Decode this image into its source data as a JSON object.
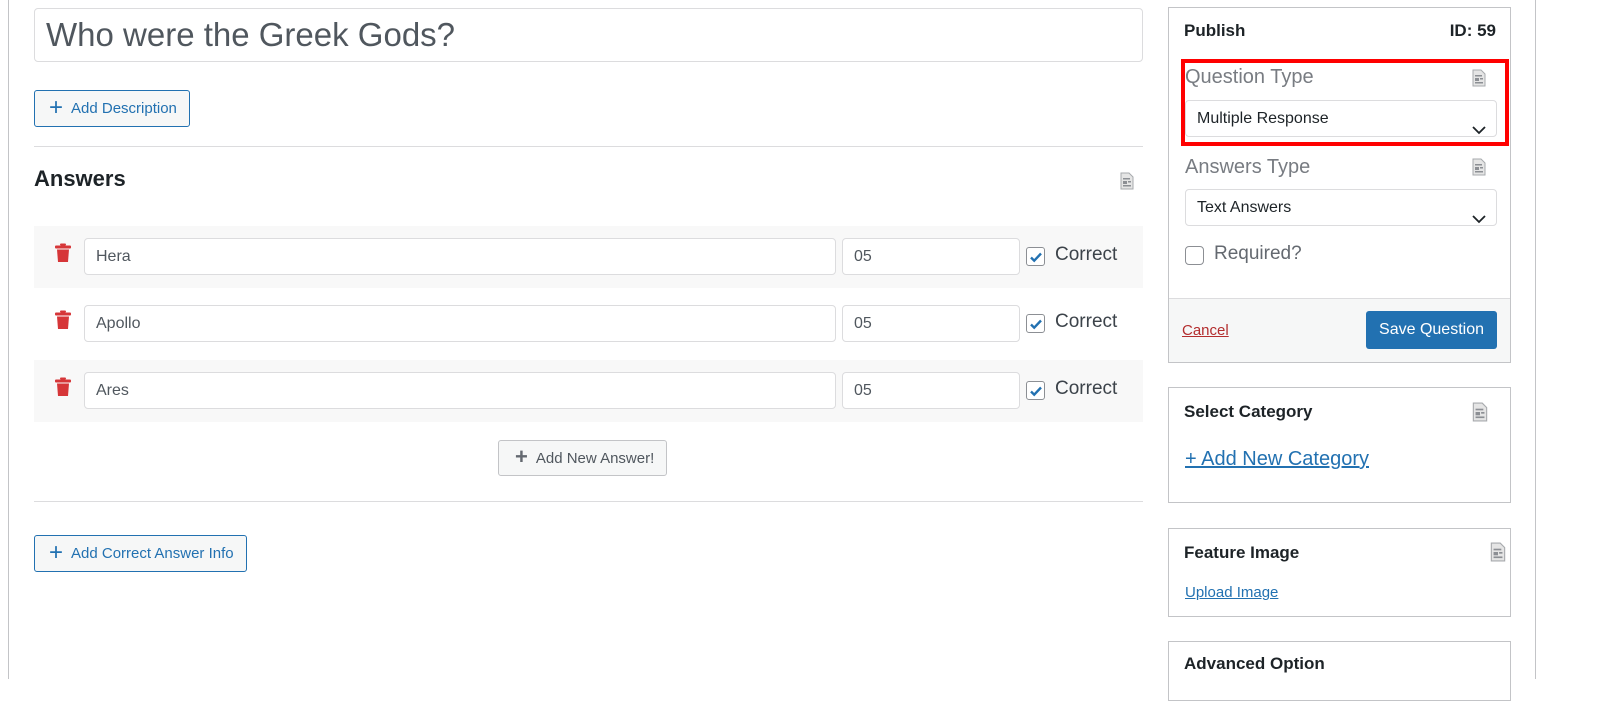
{
  "question": {
    "title": "Who were the Greek Gods?",
    "add_description_label": "Add Description"
  },
  "answers": {
    "heading": "Answers",
    "items": [
      {
        "text": "Hera",
        "points": "05",
        "correct": true,
        "correct_label": "Correct"
      },
      {
        "text": "Apollo",
        "points": "05",
        "correct": true,
        "correct_label": "Correct"
      },
      {
        "text": "Ares",
        "points": "05",
        "correct": true,
        "correct_label": "Correct"
      }
    ],
    "add_new_label": "Add New Answer!",
    "add_correct_info_label": "Add Correct Answer Info"
  },
  "publish": {
    "title": "Publish",
    "id_label": "ID: 59",
    "question_type_label": "Question Type",
    "question_type_value": "Multiple Response",
    "answers_type_label": "Answers Type",
    "answers_type_value": "Text Answers",
    "required_label": "Required?",
    "required_checked": false,
    "cancel_label": "Cancel",
    "save_label": "Save Question"
  },
  "category": {
    "title": "Select Category",
    "add_new_label": "+ Add New Category"
  },
  "feature_image": {
    "title": "Feature Image",
    "upload_label": "Upload Image"
  },
  "advanced": {
    "title": "Advanced Option"
  },
  "colors": {
    "primary": "#2271b1",
    "danger": "#d63638",
    "highlight": "#ff0000",
    "cancel": "#b32d2e"
  }
}
